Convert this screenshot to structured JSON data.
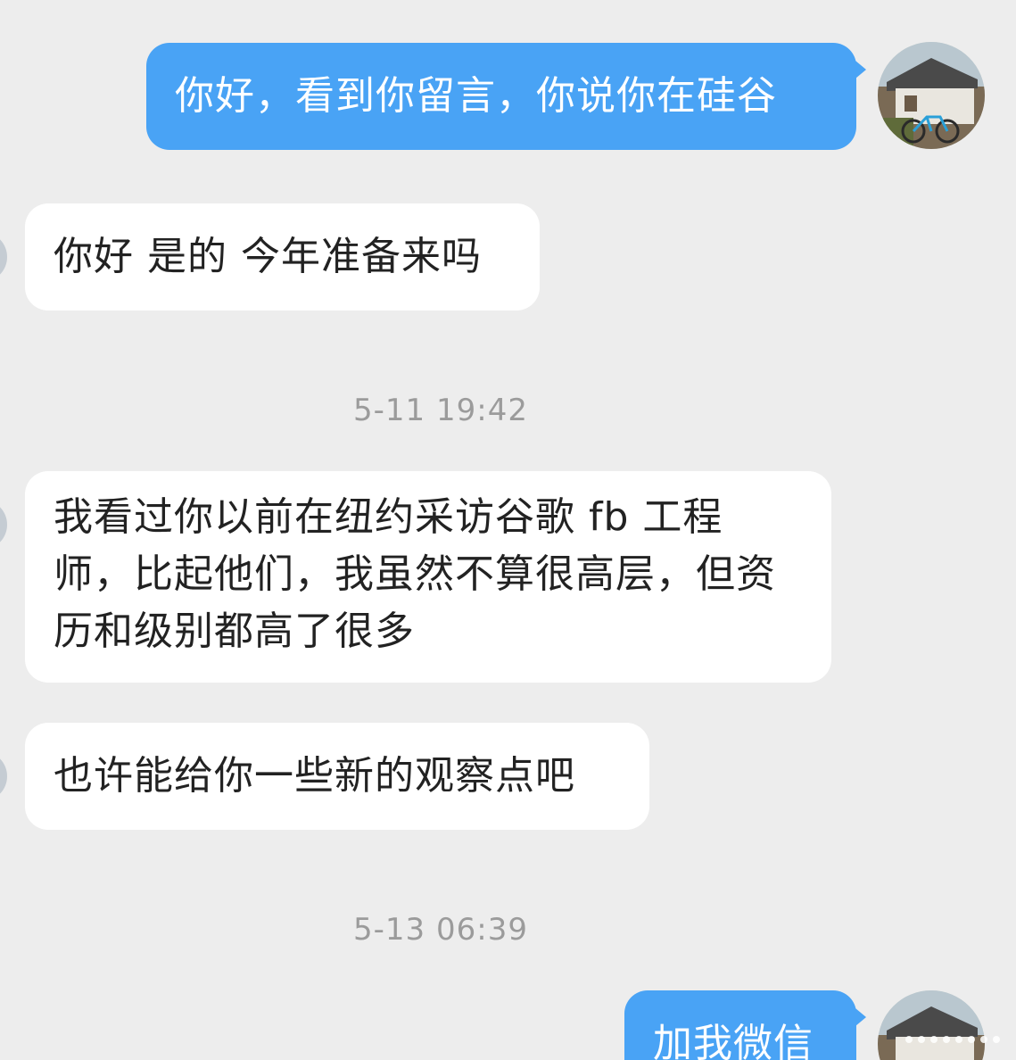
{
  "messages": [
    {
      "direction": "out",
      "text": "你好，看到你留言，你说你在硅谷"
    },
    {
      "direction": "in",
      "text": "你好 是的 今年准备来吗"
    },
    {
      "direction": "in",
      "text": "我看过你以前在纽约采访谷歌 fb 工程师，比起他们，我虽然不算很高层，但资历和级别都高了很多"
    },
    {
      "direction": "in",
      "text": "也许能给你一些新的观察点吧"
    },
    {
      "direction": "out",
      "text": "加我微信"
    }
  ],
  "timestamps": [
    "5-11 19:42",
    "5-13 06:39"
  ],
  "colors": {
    "background": "#ededed",
    "outgoing_bubble": "#49a3f5",
    "incoming_bubble": "#ffffff",
    "timestamp_text": "#9b9b9b"
  },
  "icons": {
    "self_avatar": "house-and-bicycle-photo-avatar",
    "contact_avatar": "contact-avatar"
  }
}
